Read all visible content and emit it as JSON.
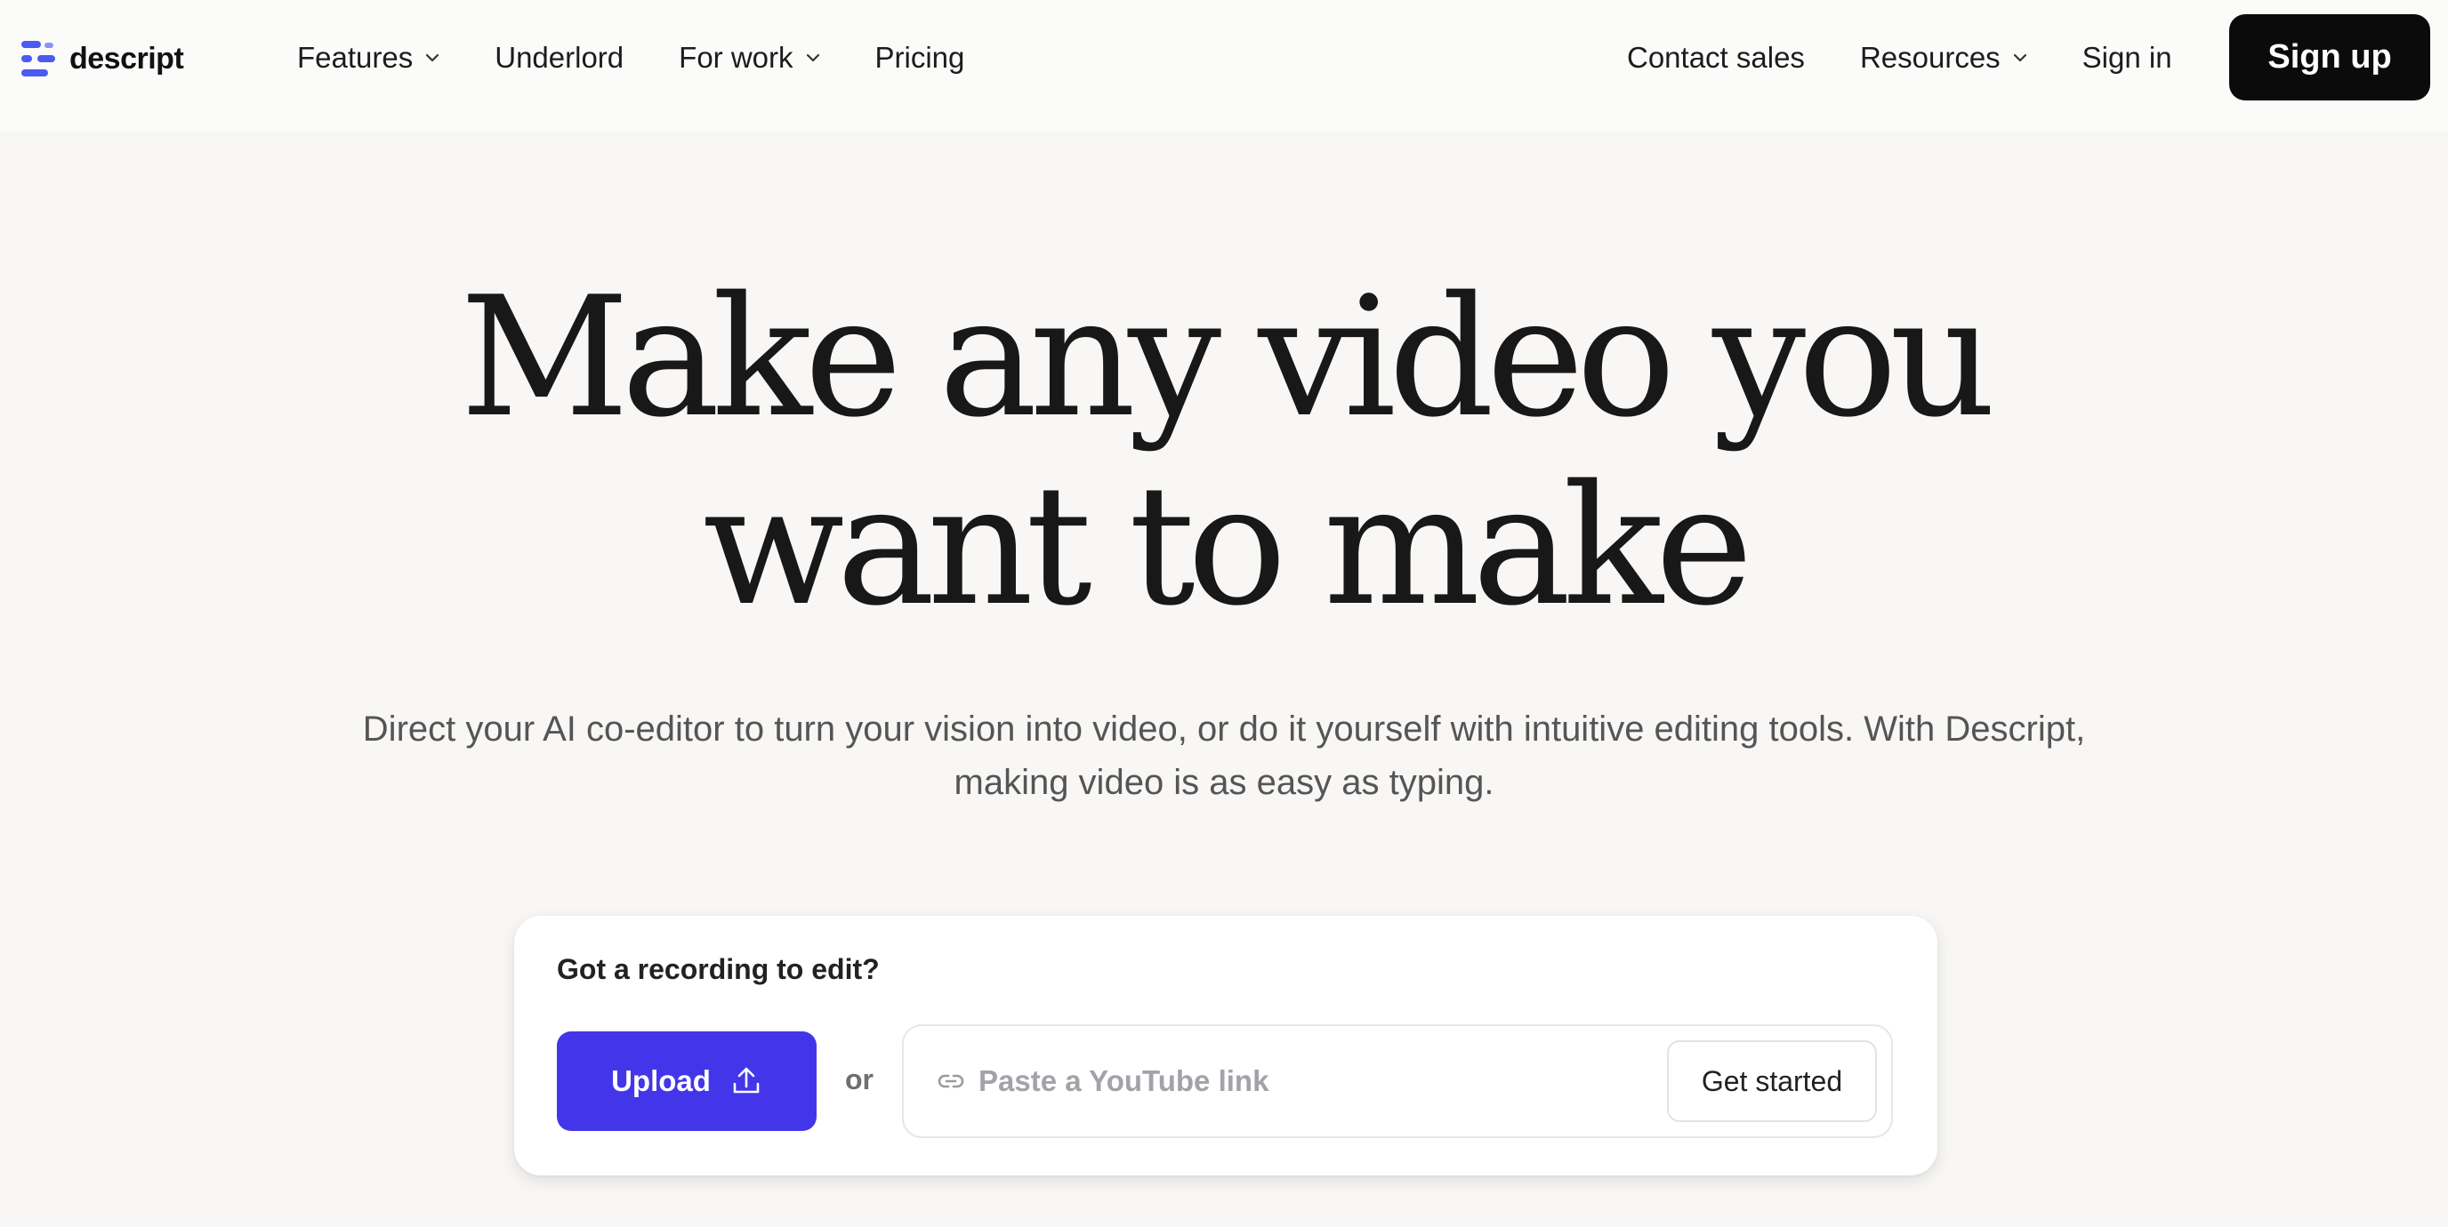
{
  "brand": {
    "name": "descript",
    "accent_color": "#4a5bf0"
  },
  "nav": {
    "left_items": [
      {
        "label": "Features",
        "has_dropdown": true
      },
      {
        "label": "Underlord",
        "has_dropdown": false
      },
      {
        "label": "For work",
        "has_dropdown": true
      },
      {
        "label": "Pricing",
        "has_dropdown": false
      }
    ],
    "right_items": [
      {
        "label": "Contact sales",
        "has_dropdown": false
      },
      {
        "label": "Resources",
        "has_dropdown": true
      },
      {
        "label": "Sign in",
        "has_dropdown": false
      }
    ],
    "signup_label": "Sign up",
    "signup_color": "#0b0b0b"
  },
  "hero": {
    "title_line1": "Make any video you",
    "title_line2": "want to make",
    "subtitle": "Direct your AI co-editor to turn your vision into video, or do it yourself with intuitive editing tools. With Descript, making video is as easy as typing."
  },
  "upload_card": {
    "prompt": "Got a recording to edit?",
    "upload_label": "Upload",
    "upload_icon": "upload-icon",
    "upload_color": "#4336ea",
    "or_label": "or",
    "link_icon": "link-icon",
    "youtube_placeholder": "Paste a YouTube link",
    "youtube_value": "",
    "get_started_label": "Get started"
  }
}
